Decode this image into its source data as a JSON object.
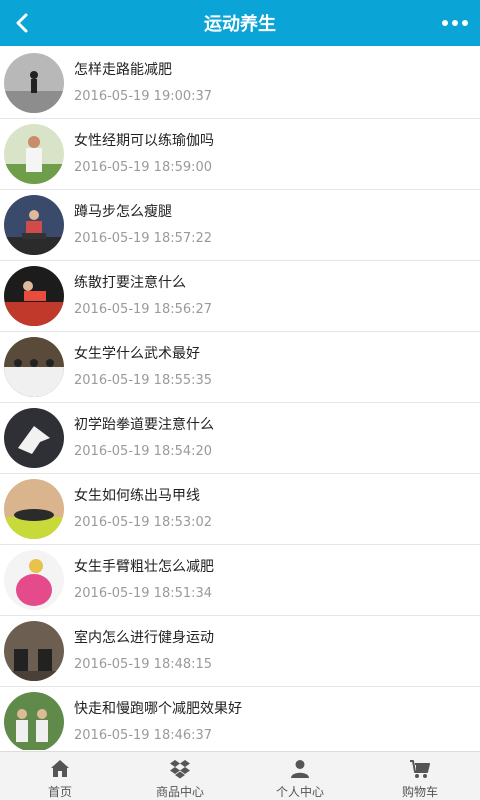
{
  "header": {
    "title": "运动养生"
  },
  "articles": [
    {
      "title": "怎样走路能减肥",
      "date": "2016-05-19 19:00:37"
    },
    {
      "title": "女性经期可以练瑜伽吗",
      "date": "2016-05-19 18:59:00"
    },
    {
      "title": "蹲马步怎么瘦腿",
      "date": "2016-05-19 18:57:22"
    },
    {
      "title": "练散打要注意什么",
      "date": "2016-05-19 18:56:27"
    },
    {
      "title": "女生学什么武术最好",
      "date": "2016-05-19 18:55:35"
    },
    {
      "title": "初学跆拳道要注意什么",
      "date": "2016-05-19 18:54:20"
    },
    {
      "title": "女生如何练出马甲线",
      "date": "2016-05-19 18:53:02"
    },
    {
      "title": "女生手臂粗壮怎么减肥",
      "date": "2016-05-19 18:51:34"
    },
    {
      "title": "室内怎么进行健身运动",
      "date": "2016-05-19 18:48:15"
    },
    {
      "title": "快走和慢跑哪个减肥效果好",
      "date": "2016-05-19 18:46:37"
    }
  ],
  "tabbar": {
    "home": "首页",
    "products": "商品中心",
    "profile": "个人中心",
    "cart": "购物车"
  },
  "colors": {
    "header": "#0aa5d6",
    "tabbar": "#f3f3f3"
  },
  "icons": {
    "back": "chevron-left-icon",
    "more": "more-dots-icon",
    "home": "home-icon",
    "products": "dropbox-icon",
    "profile": "user-icon",
    "cart": "cart-icon"
  }
}
